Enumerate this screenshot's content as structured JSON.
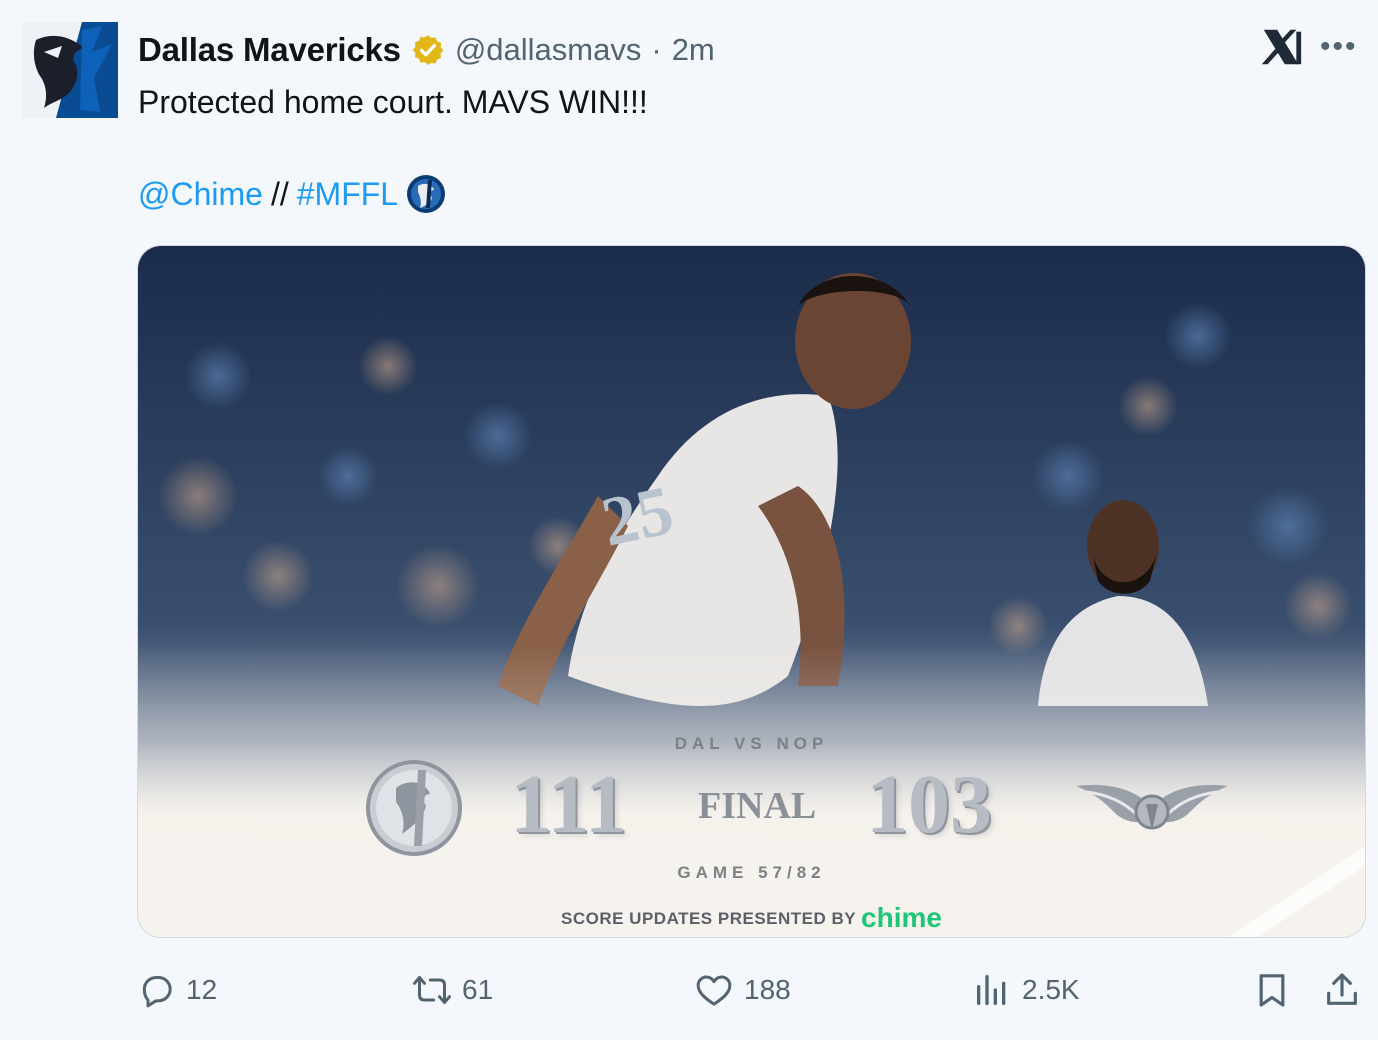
{
  "author": {
    "display_name": "Dallas Mavericks",
    "handle": "@dallasmavs",
    "separator": "·",
    "time": "2m",
    "verified_badge_color": "#e2b719"
  },
  "tweet": {
    "text": "Protected home court. MAVS WIN!!!",
    "mention": "@Chime",
    "separator": "//",
    "hashtag": "#MFFL",
    "link_color": "#1d9bf0"
  },
  "graphic": {
    "matchup": "DAL VS NOP",
    "home_score": "111",
    "status": "FINAL",
    "away_score": "103",
    "game": "GAME 57/82",
    "sponsor_prefix": "SCORE UPDATES PRESENTED BY",
    "sponsor_brand": "chime",
    "sponsor_color": "#1ec677"
  },
  "actions": {
    "replies": "12",
    "reposts": "61",
    "likes": "188",
    "views": "2.5K"
  },
  "icons": {
    "top_right": [
      "x-logo-icon",
      "more-icon"
    ],
    "action_bar": [
      "reply-icon",
      "repost-icon",
      "like-icon",
      "views-icon",
      "bookmark-icon",
      "share-icon"
    ]
  }
}
